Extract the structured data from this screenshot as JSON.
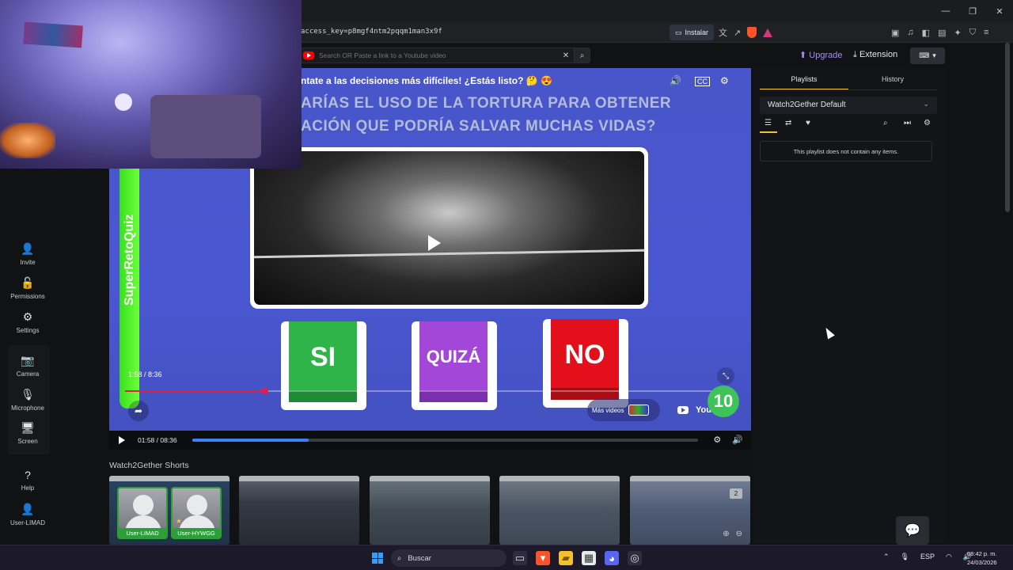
{
  "browser": {
    "url": "access_key=p8mgf4ntm2pqqm1man3x9f",
    "install_label": "Instalar",
    "window_controls": [
      "—",
      "❐",
      "✕"
    ]
  },
  "topbar": {
    "search_placeholder": "Search OR Paste a link to a Youtube video",
    "upgrade_label": "Upgrade",
    "extension_label": "Extension"
  },
  "sidebar": {
    "items": [
      {
        "label": "Invite",
        "icon": "add-user-icon"
      },
      {
        "label": "Permissions",
        "icon": "unlock-icon"
      },
      {
        "label": "Settings",
        "icon": "gear-icon"
      },
      {
        "label": "Camera",
        "icon": "camera-icon"
      },
      {
        "label": "Microphone",
        "icon": "microphone-icon"
      },
      {
        "label": "Screen",
        "icon": "monitor-icon"
      },
      {
        "label": "Help",
        "icon": "help-icon"
      },
      {
        "label": "User-LIMAD",
        "icon": "user-icon"
      }
    ]
  },
  "video": {
    "header_text": "ntate a las decisiones más difíciles! ¿Estás listo? 🤔 😍",
    "question_line1": "ARÍAS EL USO DE LA TORTURA PARA OBTENER",
    "question_line2": "ACIÓN QUE PODRÍA SALVAR MUCHAS VIDAS?",
    "brand": "SuperRetoQuiz",
    "answers": [
      {
        "label": "SI",
        "color": "#2fb44a",
        "shade": "#1f8a35"
      },
      {
        "label": "QUIZÁ",
        "color": "#a347d8",
        "shade": "#7a2fb0"
      },
      {
        "label": "NO",
        "color": "#e3101c",
        "shade": "#a80c14"
      }
    ],
    "overlay_time": "1:58 / 8:36",
    "overlay_progress": 0.23,
    "mas_videos_label": "Más videos",
    "youtube_label": "YouTube",
    "countdown": "10"
  },
  "player": {
    "time": "01:58 / 08:36",
    "progress": 0.23
  },
  "shorts": {
    "title": "Watch2Gether Shorts",
    "count_badge": "2"
  },
  "users": [
    {
      "name": "User-LIMAD"
    },
    {
      "name": "User-HYWGG"
    }
  ],
  "right_panel": {
    "tabs": [
      "Playlists",
      "History"
    ],
    "playlist_name": "Watch2Gether Default",
    "empty_message": "This playlist does not contain any items."
  },
  "taskbar": {
    "search_label": "Buscar",
    "language": "ESP",
    "time": "08:42 p. m.",
    "date": "24/03/2026"
  },
  "colors": {
    "accent_upgrade": "#a78bfa",
    "progress": "#3b82f6",
    "user_green": "#2e9e3a",
    "tab_underline": "#f2c23a"
  }
}
